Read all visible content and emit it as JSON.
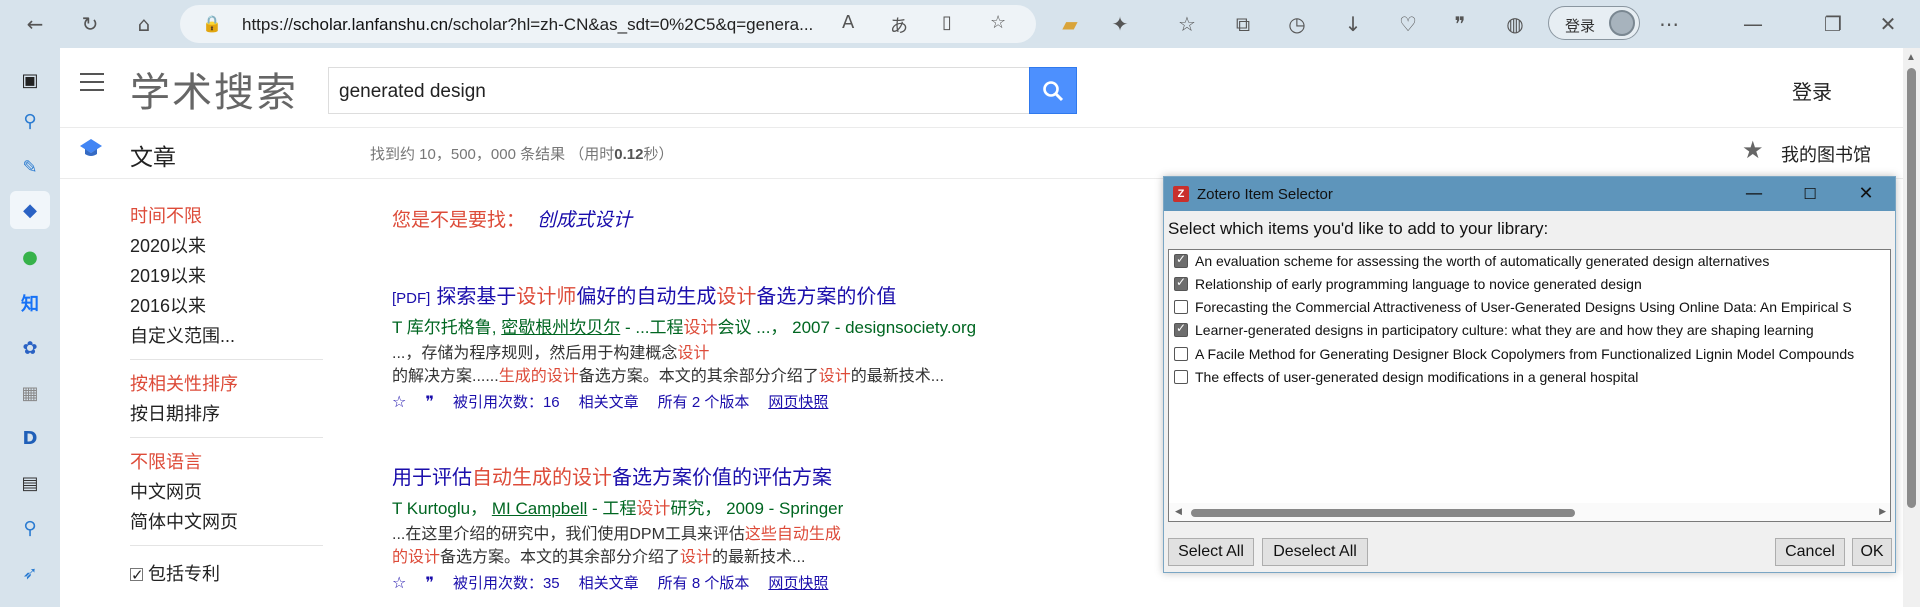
{
  "browser": {
    "url_prefix": "https://",
    "url_host": "scholar.lanfanshu.cn",
    "url_rest": "/scholar?hl=zh-CN&as_sdt=0%2C5&q=genera...",
    "login_label": "登录",
    "nav_icons": [
      "back-icon",
      "refresh-icon",
      "home-icon"
    ]
  },
  "scholar": {
    "logo": "学术搜索",
    "query": "generated design",
    "login": "登录",
    "category": "文章",
    "stats_prefix": "找到约 10，500，000 条结果 （用时",
    "stats_time": "0.12",
    "stats_suffix": "秒）",
    "library": "我的图书馆"
  },
  "filters": {
    "time": [
      "时间不限",
      "2020以来",
      "2019以来",
      "2016以来",
      "自定义范围..."
    ],
    "sort": [
      "按相关性排序",
      "按日期排序"
    ],
    "lang": [
      "不限语言",
      "中文网页",
      "简体中文网页"
    ],
    "include_patents": "包括专利"
  },
  "suggestion": {
    "prompt": "您是不是要找：",
    "term": "创成式设计"
  },
  "results": [
    {
      "tag": "[PDF]",
      "title_parts": [
        "探索基于",
        "设计师",
        "偏好的自动生成",
        "设计",
        "备选方案的价值"
      ],
      "authors_a": "T 库尔托格鲁, ",
      "authors_b": "密歇根州坎贝尔",
      "authors_c": " - ...工程",
      "authors_d": "设计",
      "authors_e": "会议 ...， 2007 - designsociety.org",
      "snippet1_a": "...，存储为程序规则，然后用于构建概念",
      "snippet1_b": "设计",
      "snippet2_a": "的解决方案......",
      "snippet2_b": "生成的设计",
      "snippet2_c": "备选方案。本文的其余部分介绍了",
      "snippet2_d": "设计",
      "snippet2_e": "的最新技术...",
      "cited": "被引用次数：16",
      "related": "相关文章",
      "versions": "所有 2 个版本",
      "cache": "网页快照"
    },
    {
      "title_parts": [
        "用于评估",
        "自动生成的设计",
        "备选方案价值的评估方案"
      ],
      "authors_a": "T Kurtoglu， ",
      "authors_b": "MI Campbell",
      "authors_c": " - 工程",
      "authors_d": "设计",
      "authors_e": "研究， 2009 - Springer",
      "snippet1_a": "...在这里介绍的研究中，我们使用DPM工具来评估",
      "snippet1_b": "这些自动生成",
      "snippet2_a": "",
      "snippet2_b": "的设计",
      "snippet2_c": "备选方案。本文的其余部分介绍了",
      "snippet2_d": "设计",
      "snippet2_e": "的最新技术...",
      "cited": "被引用次数：35",
      "related": "相关文章",
      "versions": "所有 8 个版本",
      "cache": "网页快照"
    }
  ],
  "zotero": {
    "title": "Zotero Item Selector",
    "prompt": "Select which items you'd like to add to your library:",
    "items": [
      {
        "label": "An evaluation scheme for assessing the worth of automatically generated design alternatives",
        "checked": true
      },
      {
        "label": "Relationship of early programming language to novice generated design",
        "checked": true
      },
      {
        "label": "Forecasting the Commercial Attractiveness of User-Generated Designs Using Online Data: An Empirical S",
        "checked": false
      },
      {
        "label": "Learner-generated designs in participatory culture: what they are and how they are shaping learning",
        "checked": true
      },
      {
        "label": "A Facile Method for Generating Designer Block Copolymers from Functionalized Lignin Model Compounds",
        "checked": false
      },
      {
        "label": "The effects of user-generated design modifications in a general hospital",
        "checked": false
      }
    ],
    "select_all": "Select All",
    "deselect_all": "Deselect All",
    "cancel": "Cancel",
    "ok": "OK"
  },
  "colors": {
    "accent_blue": "#4d90fe",
    "scholar_red": "#dd4b39",
    "link": "#1a0dab",
    "green": "#006621",
    "dialog_title": "#5e95bb"
  }
}
